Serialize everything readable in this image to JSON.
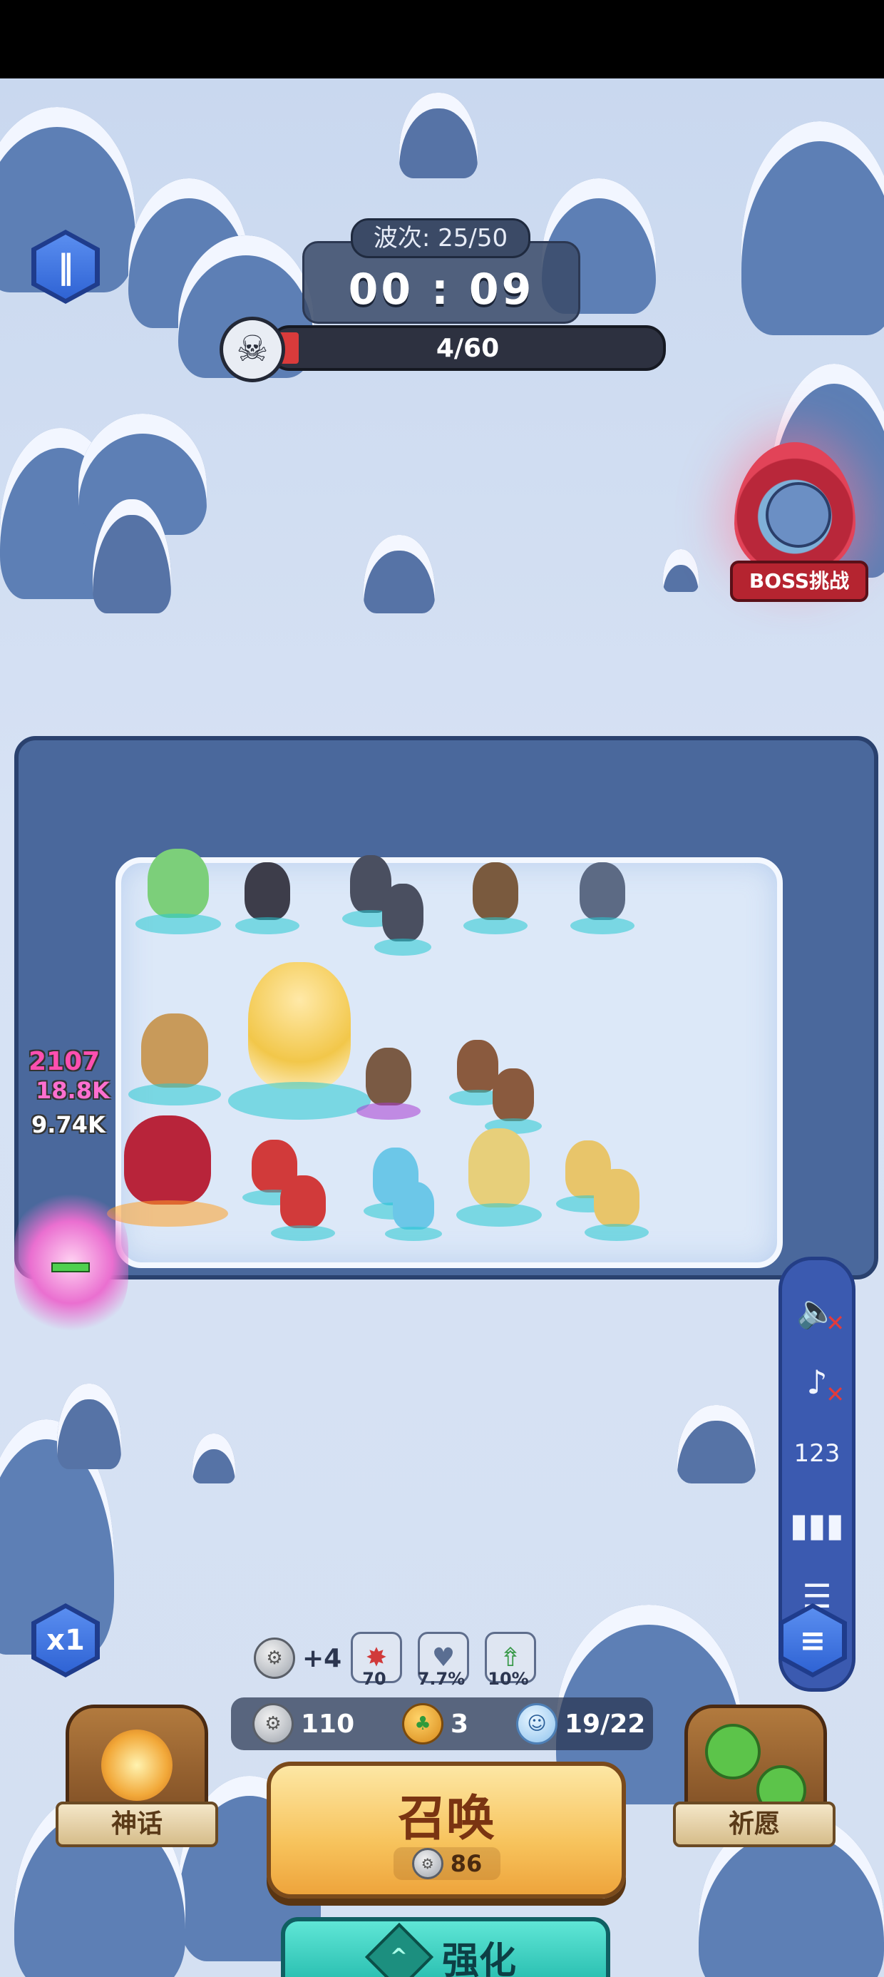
{
  "hud": {
    "wave_label": "波次: 25/50",
    "timer": "00 : 09",
    "enemy_count": "4/60",
    "enemy_progress": 0.067,
    "pause_icon": "pause-icon"
  },
  "boss": {
    "label": "BOSS挑战"
  },
  "board": {
    "float_numbers": [
      "2107",
      "18.8K",
      "9.74K"
    ]
  },
  "stats": {
    "silver_bonus": "+4",
    "crit_value": "70",
    "heart_value": "7.7%",
    "upgrade_value": "10%"
  },
  "resources": {
    "silver": "110",
    "clover": "3",
    "units": "19/22"
  },
  "speed": {
    "label": "x1"
  },
  "summon": {
    "title": "召唤",
    "cost": "86"
  },
  "upgrade": {
    "label": "强化"
  },
  "shrines": {
    "myth_label": "神话",
    "wish_label": "祈愿"
  },
  "side_panel": {
    "items": [
      "sound-off-icon",
      "music-off-icon",
      "damage-numbers-icon",
      "stats-icon",
      "log-icon"
    ]
  },
  "colors": {
    "accent_blue": "#2f63d4",
    "summon_gold": "#f7c35c",
    "upgrade_teal": "#1fb7a9",
    "boss_red": "#b52430"
  }
}
